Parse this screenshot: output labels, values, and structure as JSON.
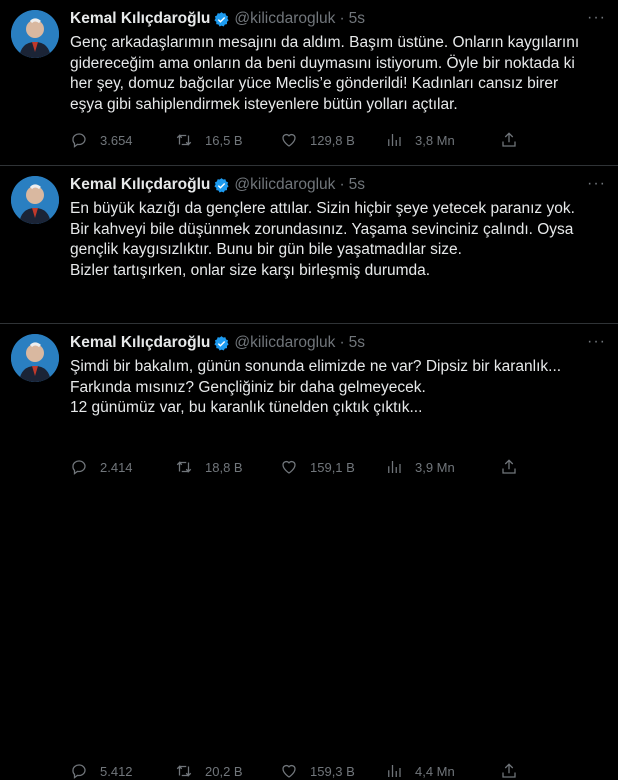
{
  "tweets": [
    {
      "author": "Kemal Kılıçdaroğlu",
      "handle": "@kilicdarogluk",
      "time": "5s",
      "text": "Genç arkadaşlarımın mesajını da aldım. Başım üstüne. Onların kaygılarını\ngidereceğim ama onların da beni duymasını istiyorum. Öyle bir noktada ki\nher şey, domuz bağcılar yüce Meclis’e gönderildi! Kadınları cansız birer\neşya gibi sahiplendirmek isteyenlere bütün yolları açtılar.",
      "replies": "3.654",
      "retweets": "16,5 B",
      "likes": "129,8 B",
      "views": "3,8 Mn"
    },
    {
      "author": "Kemal Kılıçdaroğlu",
      "handle": "@kilicdarogluk",
      "time": "5s",
      "text": "En büyük kazığı da gençlere attılar. Sizin hiçbir şeye yetecek paranız yok.\nBir kahveyi bile düşünmek zorundasınız. Yaşama sevinciniz çalındı. Oysa\ngençlik kaygısızlıktır. Bunu bir gün bile yaşatmadılar size.\nBizler tartışırken, onlar size karşı birleşmiş durumda.",
      "replies": "2.414",
      "retweets": "18,8 B",
      "likes": "159,1 B",
      "views": "3,9 Mn"
    },
    {
      "author": "Kemal Kılıçdaroğlu",
      "handle": "@kilicdarogluk",
      "time": "5s",
      "text": "Şimdi bir bakalım, günün sonunda elimizde ne var?  Dipsiz bir karanlık...\nFarkında mısınız? Gençliğiniz bir daha gelmeyecek.\n12 günümüz var, bu karanlık tünelden çıktık çıktık...",
      "replies": "5.412",
      "retweets": "20,2 B",
      "likes": "159,3 B",
      "views": "4,4 Mn"
    }
  ],
  "more_glyph": "···",
  "dot_glyph": "·",
  "colors": {
    "background": "#000000",
    "text": "#e7e9ea",
    "muted": "#71767b",
    "verified": "#1d9bf0",
    "divider": "#2f3336"
  },
  "icons": [
    "avatar",
    "verified-badge-icon",
    "reply-icon",
    "retweet-icon",
    "like-icon",
    "views-icon",
    "share-icon",
    "more-icon"
  ]
}
